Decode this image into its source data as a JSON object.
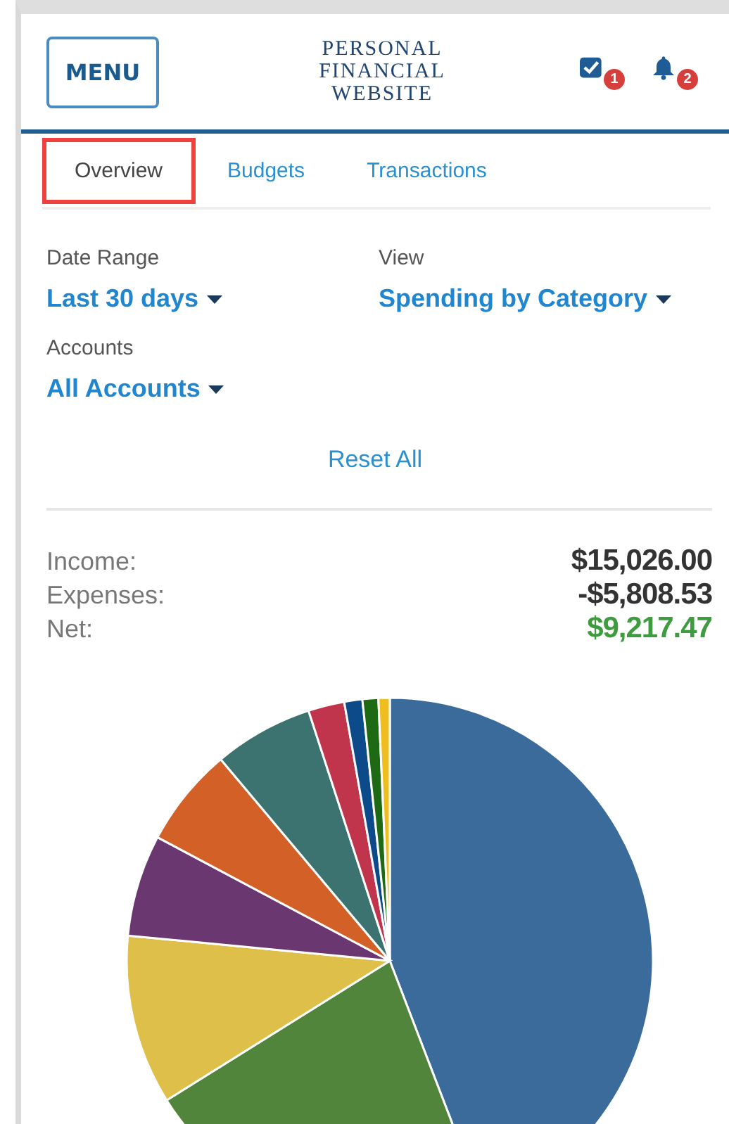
{
  "header": {
    "menu_button": "MENU",
    "title": [
      "PERSONAL",
      "FINANCIAL",
      "WEBSITE"
    ],
    "tasks_badge": "1",
    "notifications_badge": "2"
  },
  "tabs": [
    {
      "label": "Overview",
      "selected": true
    },
    {
      "label": "Budgets",
      "selected": false
    },
    {
      "label": "Transactions",
      "selected": false
    }
  ],
  "filters": [
    {
      "label": "Date Range",
      "value": "Last 30 days"
    },
    {
      "label": "View",
      "value": "Spending by Category"
    },
    {
      "label": "Accounts",
      "value": "All Accounts"
    }
  ],
  "reset_link": "Reset All",
  "summary": [
    {
      "label": "Income:",
      "value": "$15,026.00",
      "color": "#333333"
    },
    {
      "label": "Expenses:",
      "value": "-$5,808.53",
      "color": "#333333"
    },
    {
      "label": "Net:",
      "value": "$9,217.47",
      "color": "#3f9b3f"
    }
  ]
}
